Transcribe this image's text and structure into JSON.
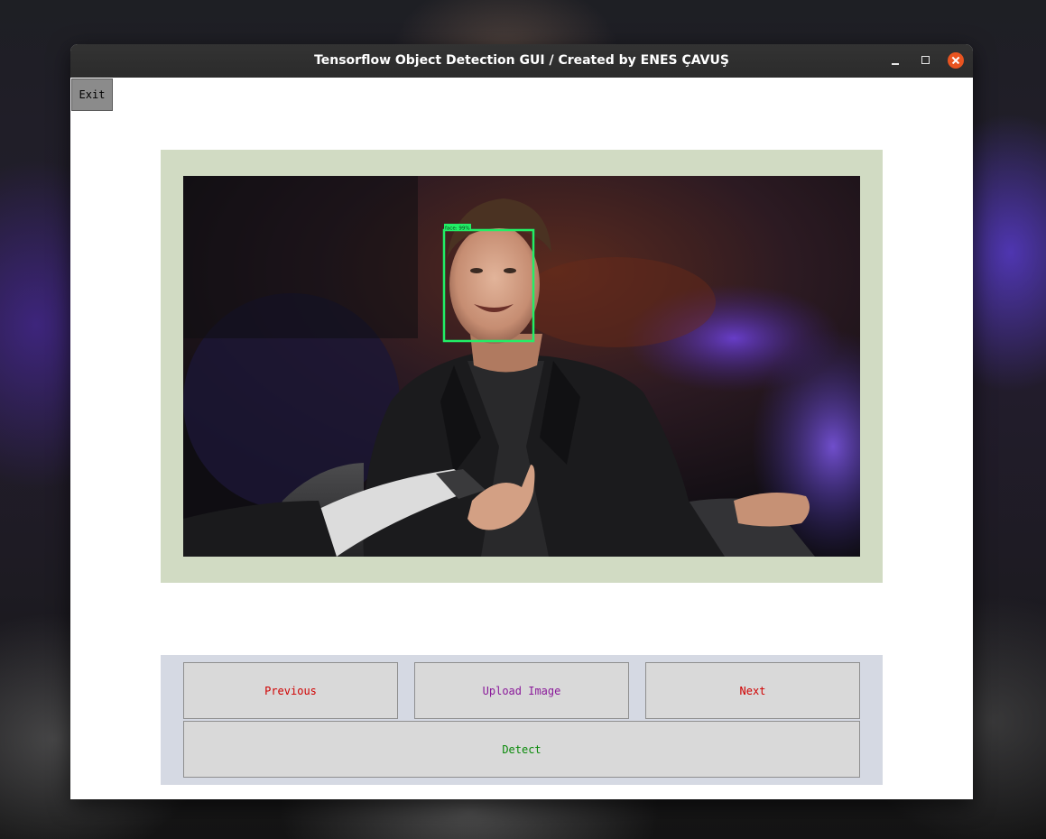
{
  "window": {
    "title": "Tensorflow Object Detection GUI / Created by ENES ÇAVUŞ"
  },
  "toolbar": {
    "exit_label": "Exit"
  },
  "image_view": {
    "detection_label": "face: 99%",
    "box_color": "#22ee66"
  },
  "controls": {
    "previous_label": "Previous",
    "upload_label": "Upload Image",
    "next_label": "Next",
    "detect_label": "Detect"
  },
  "colors": {
    "close_button": "#e95420",
    "frame_bg": "#d1dbc3",
    "controls_bg": "#d5d9e3",
    "previous_text": "#d00000",
    "upload_text": "#8a1a9a",
    "next_text": "#d00000",
    "detect_text": "#0a8a0a"
  }
}
